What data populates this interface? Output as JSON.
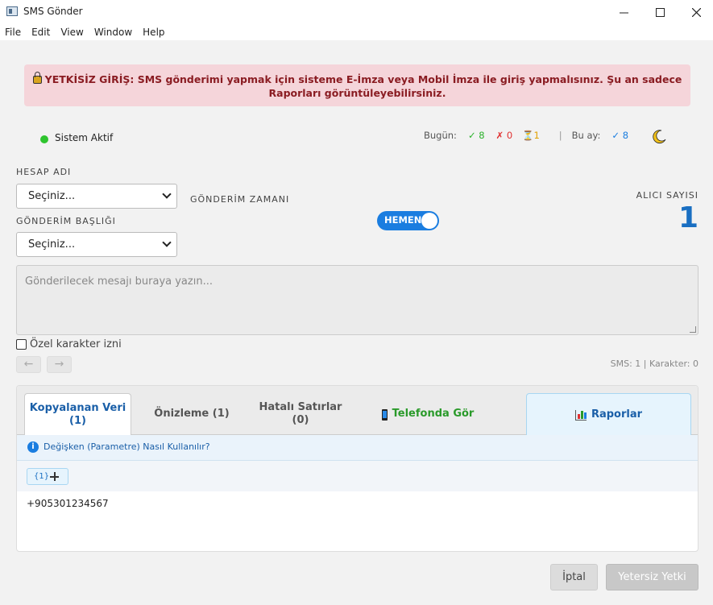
{
  "window": {
    "title": "SMS Gönder"
  },
  "menu": [
    "File",
    "Edit",
    "View",
    "Window",
    "Help"
  ],
  "alert": {
    "text": "YETKİSİZ GİRİŞ: SMS gönderimi yapmak için sisteme E-İmza veya Mobil İmza ile giriş yapmalısınız. Şu an sadece Raporları görüntüleyebilirsiniz."
  },
  "status": {
    "text": "Sistem Aktif",
    "today_label": "Bugün:",
    "today_ok": "✓ 8",
    "today_fail": "✗ 0",
    "today_pending": "⏳1",
    "separator": "|",
    "month_label": "Bu ay:",
    "month_ok": "✓ 8"
  },
  "form": {
    "account_label": "HESAP ADI",
    "account_value": "Seçiniz...",
    "header_label": "GÖNDERİM BAŞLIĞI",
    "header_value": "Seçiniz...",
    "schedule_label": "GÖNDERİM ZAMANI",
    "schedule_toggle": "HEMEN",
    "recipient_label": "ALICI SAYISI",
    "recipient_count": "1",
    "message_placeholder": "Gönderilecek mesajı buraya yazın...",
    "special_chars_label": "Özel karakter izni",
    "undo": "←",
    "redo": "→",
    "sms_info": "SMS: 1 | Karakter: 0"
  },
  "tabs": [
    {
      "label": "Kopyalanan Veri",
      "sub": "(1)"
    },
    {
      "label": "Önizleme (1)"
    },
    {
      "label": "Hatalı Satırlar",
      "sub": "(0)"
    },
    {
      "label": "Telefonda Gör"
    },
    {
      "label": "Raporlar"
    }
  ],
  "panel": {
    "help_text": "Değişken (Parametre) Nasıl Kullanılır?",
    "chip_label": "{1}",
    "rows": [
      "+905301234567"
    ]
  },
  "buttons": {
    "cancel": "İptal",
    "submit": "Yetersiz Yetki"
  }
}
